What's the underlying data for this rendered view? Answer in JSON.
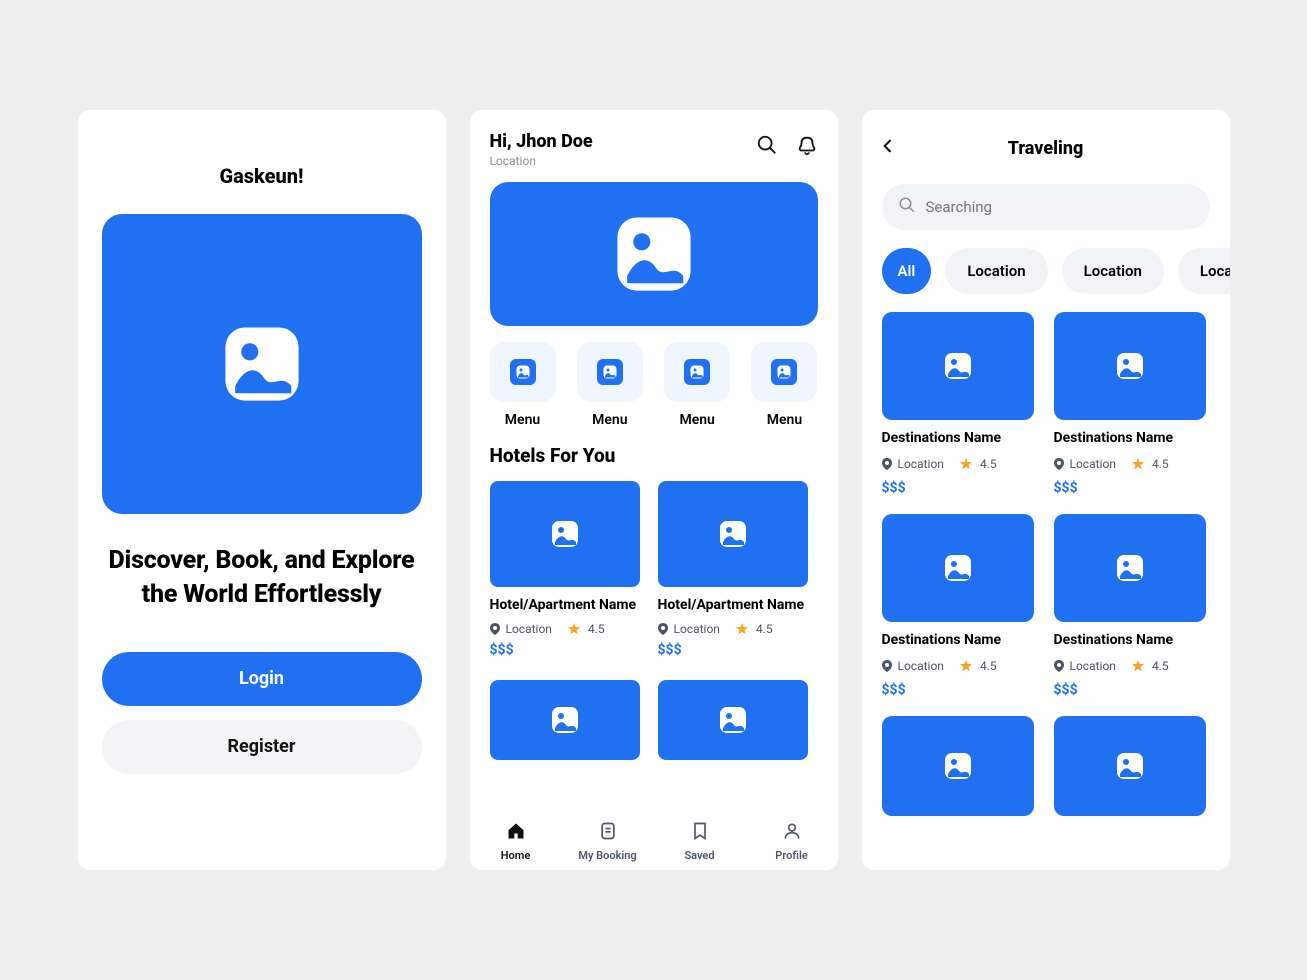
{
  "colors": {
    "primary": "#1f71f2",
    "muted_bg": "#f1f4f6",
    "soft_blue": "#eff6ff"
  },
  "screen1": {
    "brand": "Gaskeun!",
    "tagline": "Discover, Book, and Explore the World Effortlessly",
    "login_label": "Login",
    "register_label": "Register"
  },
  "screen2": {
    "greeting": "Hi, Jhon Doe",
    "location_sub": "Location",
    "menu_items": [
      {
        "label": "Menu"
      },
      {
        "label": "Menu"
      },
      {
        "label": "Menu"
      },
      {
        "label": "Menu"
      }
    ],
    "section_title": "Hotels For You",
    "hotels": [
      {
        "title": "Hotel/Apartment Name",
        "location": "Location",
        "rating": "4.5",
        "price": "$$$"
      },
      {
        "title": "Hotel/Apartment Name",
        "location": "Location",
        "rating": "4.5",
        "price": "$$$"
      }
    ],
    "nav": [
      {
        "label": "Home",
        "active": true
      },
      {
        "label": "My Booking",
        "active": false
      },
      {
        "label": "Saved",
        "active": false
      },
      {
        "label": "Profile",
        "active": false
      }
    ]
  },
  "screen3": {
    "title": "Traveling",
    "search_placeholder": "Searching",
    "chips": [
      {
        "label": "All",
        "active": true
      },
      {
        "label": "Location",
        "active": false
      },
      {
        "label": "Location",
        "active": false
      },
      {
        "label": "Location",
        "active": false
      }
    ],
    "destinations": [
      {
        "title": "Destinations Name",
        "location": "Location",
        "rating": "4.5",
        "price": "$$$"
      },
      {
        "title": "Destinations Name",
        "location": "Location",
        "rating": "4.5",
        "price": "$$$"
      },
      {
        "title": "Destinations Name",
        "location": "Location",
        "rating": "4.5",
        "price": "$$$"
      },
      {
        "title": "Destinations Name",
        "location": "Location",
        "rating": "4.5",
        "price": "$$$"
      }
    ]
  }
}
